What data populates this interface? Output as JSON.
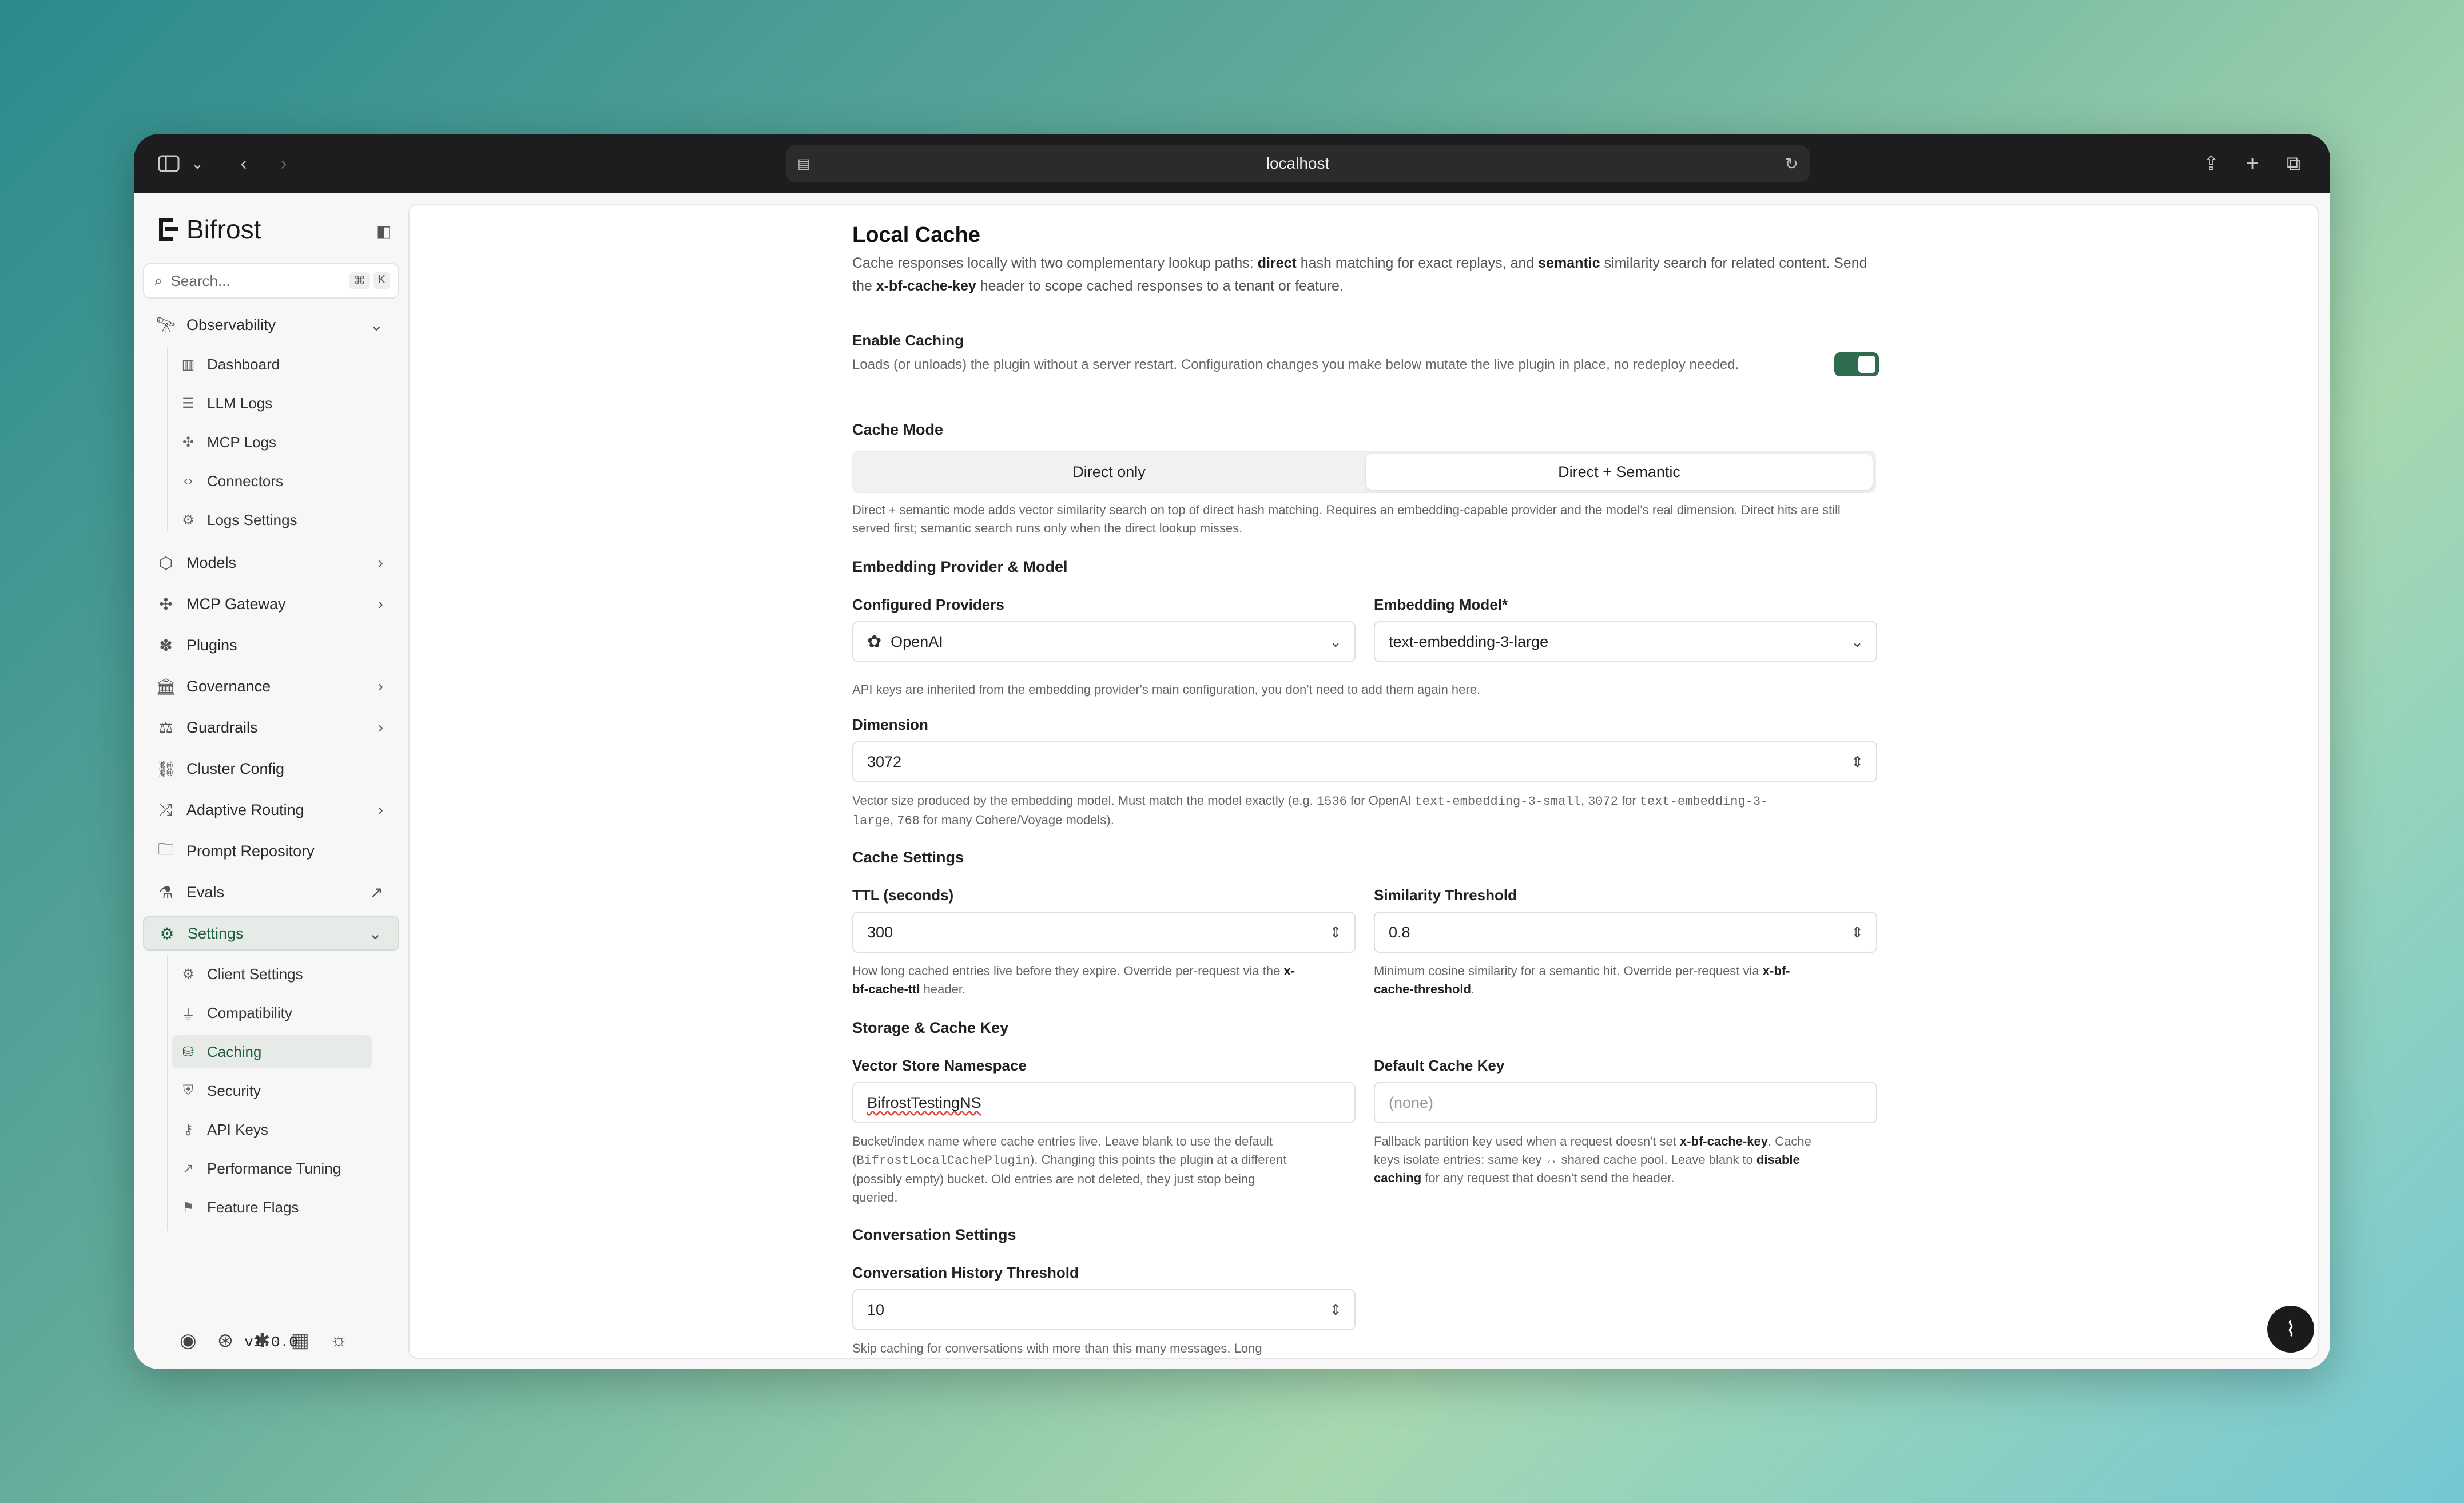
{
  "browser": {
    "url": "localhost"
  },
  "sidebar": {
    "brand": "Bifrost",
    "search_placeholder": "Search...",
    "search_kbd": [
      "⌘",
      "K"
    ],
    "items": [
      {
        "label": "Observability"
      },
      {
        "label": "Models"
      },
      {
        "label": "MCP Gateway"
      },
      {
        "label": "Plugins"
      },
      {
        "label": "Governance"
      },
      {
        "label": "Guardrails"
      },
      {
        "label": "Cluster Config"
      },
      {
        "label": "Adaptive Routing"
      },
      {
        "label": "Prompt Repository"
      },
      {
        "label": "Evals"
      },
      {
        "label": "Settings"
      }
    ],
    "observability_sub": [
      "Dashboard",
      "LLM Logs",
      "MCP Logs",
      "Connectors",
      "Logs Settings"
    ],
    "settings_sub": [
      "Client Settings",
      "Compatibility",
      "Caching",
      "Security",
      "API Keys",
      "Performance Tuning",
      "Feature Flags"
    ],
    "version": "v1.0.0"
  },
  "page": {
    "title": "Local Cache",
    "desc_1": "Cache responses locally with two complementary lookup paths: ",
    "desc_direct": "direct",
    "desc_2": " hash matching for exact replays, and ",
    "desc_semantic": "semantic",
    "desc_3": " similarity search for related content. Send the ",
    "desc_header": "x-bf-cache-key",
    "desc_4": " header to scope cached responses to a tenant or feature.",
    "enable": {
      "label": "Enable Caching",
      "help": "Loads (or unloads) the plugin without a server restart. Configuration changes you make below mutate the live plugin in place, no redeploy needed.",
      "on": true
    },
    "cache_mode": {
      "label": "Cache Mode",
      "options": [
        "Direct only",
        "Direct + Semantic"
      ],
      "selected": "Direct + Semantic",
      "help": "Direct + semantic mode adds vector similarity search on top of direct hash matching. Requires an embedding-capable provider and the model's real dimension. Direct hits are still served first; semantic search runs only when the direct lookup misses."
    },
    "embedding": {
      "section": "Embedding Provider & Model",
      "providers_label": "Configured Providers",
      "provider_value": "OpenAI",
      "model_label": "Embedding Model*",
      "model_value": "text-embedding-3-large",
      "help": "API keys are inherited from the embedding provider's main configuration, you don't need to add them again here."
    },
    "dimension": {
      "label": "Dimension",
      "value": "3072",
      "help_1": "Vector size produced by the embedding model. Must match the model exactly (e.g. ",
      "help_c1": "1536",
      "help_2": " for OpenAI ",
      "help_c2": "text-embedding-3-small",
      "help_3": ", ",
      "help_c3": "3072",
      "help_4": " for ",
      "help_c4": "text-embedding-3-",
      "help_c5": "large",
      "help_5": ", ",
      "help_c6": "768",
      "help_6": " for many Cohere/Voyage models)."
    },
    "cache_settings": {
      "section": "Cache Settings",
      "ttl_label": "TTL (seconds)",
      "ttl_value": "300",
      "ttl_help_1": "How long cached entries live before they expire. Override per-request via the ",
      "ttl_help_b1": "x-",
      "ttl_help_b2": "bf-cache-ttl",
      "ttl_help_2": " header.",
      "sim_label": "Similarity Threshold",
      "sim_value": "0.8",
      "sim_help_1": "Minimum cosine similarity for a semantic hit. Override per-request via ",
      "sim_help_b1": "x-bf-",
      "sim_help_b2": "cache-threshold",
      "sim_help_2": "."
    },
    "storage": {
      "section": "Storage & Cache Key",
      "ns_label": "Vector Store Namespace",
      "ns_value": "BifrostTestingNS",
      "ns_help_1": "Bucket/index name where cache entries live. Leave blank to use the default",
      "ns_help_2": "(",
      "ns_help_code": "BifrostLocalCachePlugin",
      "ns_help_3": "). Changing this points the plugin at a different",
      "ns_help_4": "(possibly empty) bucket. Old entries are not deleted, they just stop being",
      "ns_help_5": "queried.",
      "key_label": "Default Cache Key",
      "key_placeholder": "(none)",
      "key_help_1": "Fallback partition key used when a request doesn't set ",
      "key_help_b": "x-bf-cache-key",
      "key_help_2": ". Cache",
      "key_help_3": "keys isolate entries: same key ↔ shared cache pool. Leave blank to ",
      "key_help_b2": "disable",
      "key_help_b3": "caching",
      "key_help_4": " for any request that doesn't send the header."
    },
    "conversation": {
      "section": "Conversation Settings",
      "hist_label": "Conversation History Threshold",
      "hist_value": "10",
      "hist_help": "Skip caching for conversations with more than this many messages. Long"
    }
  }
}
